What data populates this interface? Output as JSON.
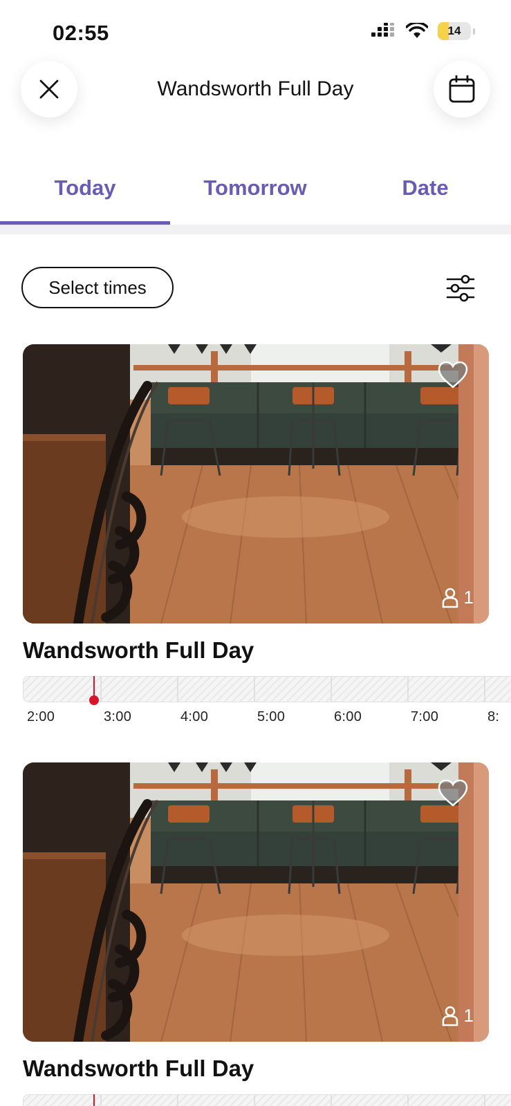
{
  "status_bar": {
    "time": "02:55",
    "battery": "14"
  },
  "header": {
    "title": "Wandsworth Full Day"
  },
  "tabs": [
    {
      "label": "Today",
      "active": true
    },
    {
      "label": "Tomorrow",
      "active": false
    },
    {
      "label": "Date",
      "active": false
    }
  ],
  "filters": {
    "select_times_label": "Select times"
  },
  "colors": {
    "accent": "#6a5bb5",
    "now_marker": "#d9152b"
  },
  "timeline_hours": [
    "2:00",
    "3:00",
    "4:00",
    "5:00",
    "6:00",
    "7:00",
    "8:"
  ],
  "cards": [
    {
      "title": "Wandsworth Full Day",
      "capacity": "1",
      "favorite_icon": "heart-icon"
    },
    {
      "title": "Wandsworth Full Day",
      "capacity": "1",
      "favorite_icon": "heart-icon"
    }
  ]
}
